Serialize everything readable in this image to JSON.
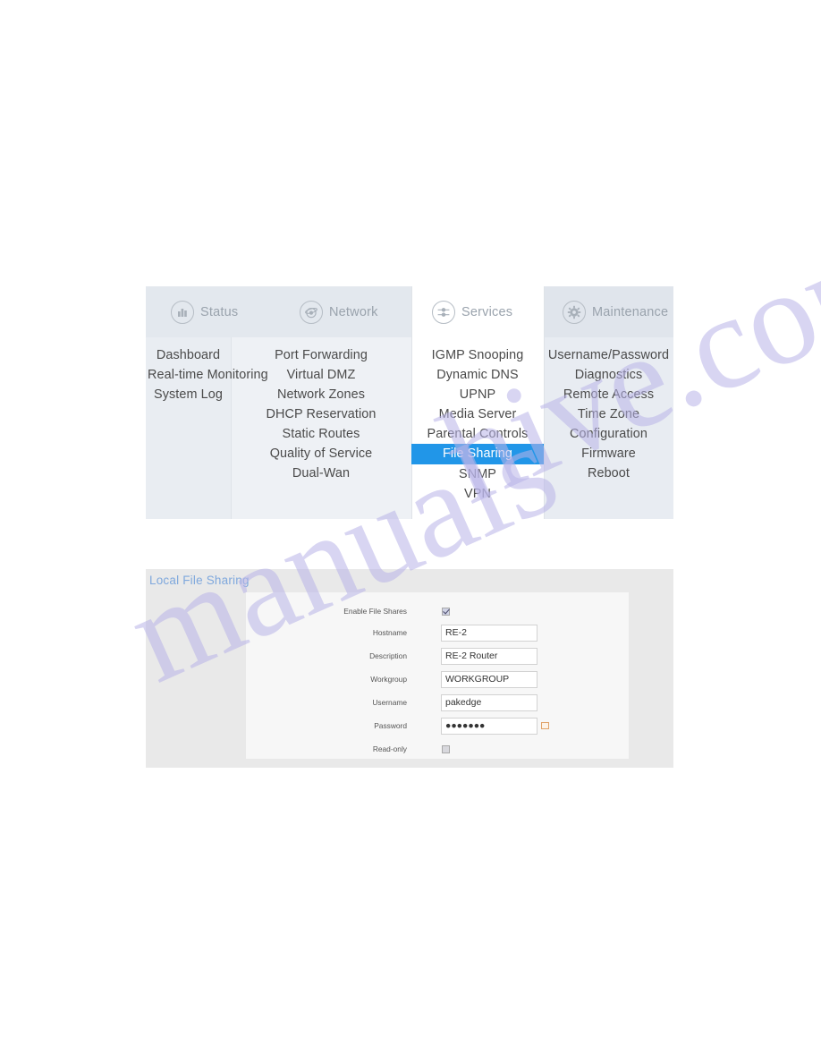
{
  "watermark": {
    "part1": "manuals",
    "part2": "hive.com"
  },
  "menu": {
    "groups": [
      {
        "key": "status",
        "title": "Status",
        "icon": "bar-chart-icon",
        "items": [
          "Dashboard",
          "Real-time Monitoring",
          "System Log"
        ]
      },
      {
        "key": "network",
        "title": "Network",
        "icon": "globe-orbit-icon",
        "items": [
          "Port Forwarding",
          "Virtual DMZ",
          "Network Zones",
          "DHCP Reservation",
          "Static Routes",
          "Quality of Service",
          "Dual-Wan"
        ]
      },
      {
        "key": "services",
        "title": "Services",
        "icon": "sliders-icon",
        "items": [
          "IGMP Snooping",
          "Dynamic DNS",
          "UPNP",
          "Media Server",
          "Parental Controls",
          "File Sharing",
          "SNMP",
          "VPN"
        ],
        "active_item": "File Sharing"
      },
      {
        "key": "maintenance",
        "title": "Maintenance",
        "icon": "gear-icon",
        "items": [
          "Username/Password",
          "Diagnostics",
          "Remote Access",
          "Time Zone",
          "Configuration",
          "Firmware",
          "Reboot"
        ]
      }
    ],
    "active_color": "#2196e8"
  },
  "form": {
    "title": "Local File Sharing",
    "title_color": "#7fa8dd",
    "rows": [
      {
        "label": "Enable File Shares",
        "type": "checkbox",
        "checked": true
      },
      {
        "label": "Hostname",
        "type": "text",
        "value": "RE-2"
      },
      {
        "label": "Description",
        "type": "text",
        "value": "RE-2 Router"
      },
      {
        "label": "Workgroup",
        "type": "text",
        "value": "WORKGROUP"
      },
      {
        "label": "Username",
        "type": "text",
        "value": "pakedge"
      },
      {
        "label": "Password",
        "type": "password",
        "value": "●●●●●●●"
      },
      {
        "label": "Read-only",
        "type": "checkbox",
        "checked": false
      }
    ]
  }
}
